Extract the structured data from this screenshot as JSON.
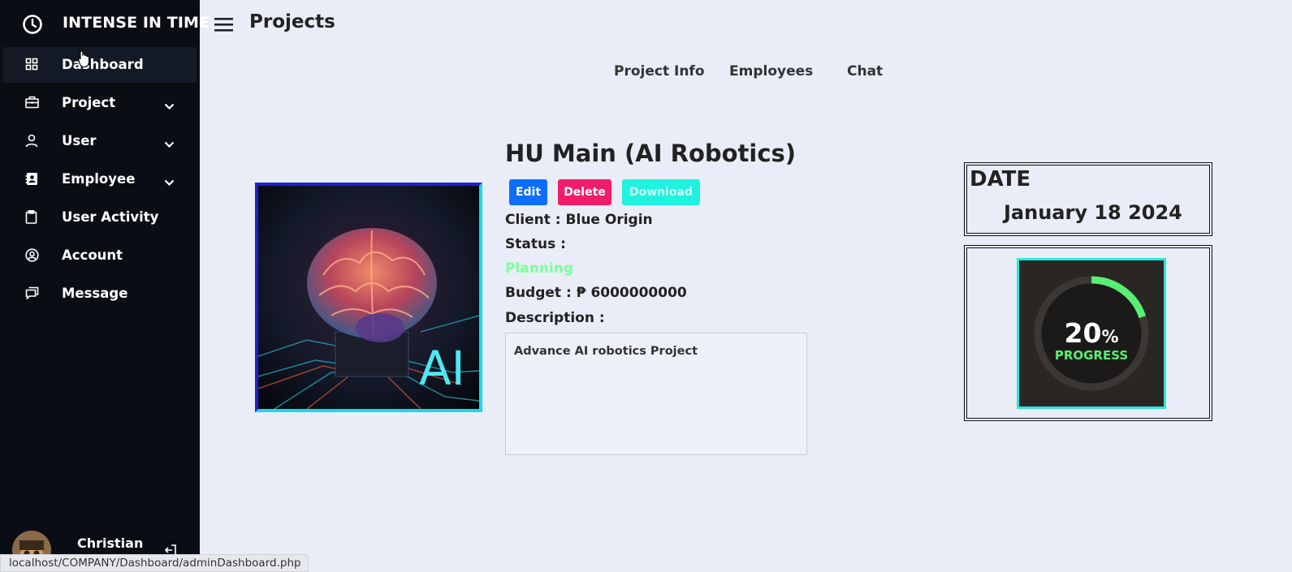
{
  "app": {
    "brand": "INTENSE IN TIME"
  },
  "sidebar": {
    "items": [
      {
        "label": "Dashboard",
        "icon": "grid-icon",
        "active": true
      },
      {
        "label": "Project",
        "icon": "briefcase-icon",
        "has_submenu": true
      },
      {
        "label": "User",
        "icon": "person-icon",
        "has_submenu": true
      },
      {
        "label": "Employee",
        "icon": "contact-card-icon",
        "has_submenu": true
      },
      {
        "label": "User Activity",
        "icon": "clipboard-icon"
      },
      {
        "label": "Account",
        "icon": "user-circle-icon"
      },
      {
        "label": "Message",
        "icon": "chat-icon"
      }
    ],
    "user": {
      "name": "Christian"
    }
  },
  "header": {
    "title": "Projects"
  },
  "tabs": [
    {
      "label": "Project Info"
    },
    {
      "label": "Employees"
    },
    {
      "label": "Chat"
    }
  ],
  "project": {
    "title": "HU Main (AI Robotics)",
    "image_text": "AI",
    "buttons": {
      "edit": "Edit",
      "delete": "Delete",
      "download": "Download"
    },
    "client_label": "Client :",
    "client_value": "Blue Origin",
    "status_label": "Status :",
    "status_value": "Planning",
    "budget_label": "Budget :",
    "budget_value": "₱ 6000000000",
    "description_label": "Description :",
    "description_value": "Advance AI robotics Project"
  },
  "date_panel": {
    "label": "DATE",
    "value": "January 18 2024"
  },
  "progress": {
    "value": "20",
    "symbol": "%",
    "label": "PROGRESS",
    "fraction": 0.2
  },
  "status_bar": {
    "url": "localhost/COMPANY/Dashboard/adminDashboard.php"
  },
  "colors": {
    "sidebar_bg": "#0a0e14",
    "page_bg": "#e9edf7",
    "edit": "#0d6efd",
    "delete": "#f01d6b",
    "download": "#1ff2df",
    "status_planning": "#7dff9b",
    "progress_ring": "#58ef74"
  }
}
